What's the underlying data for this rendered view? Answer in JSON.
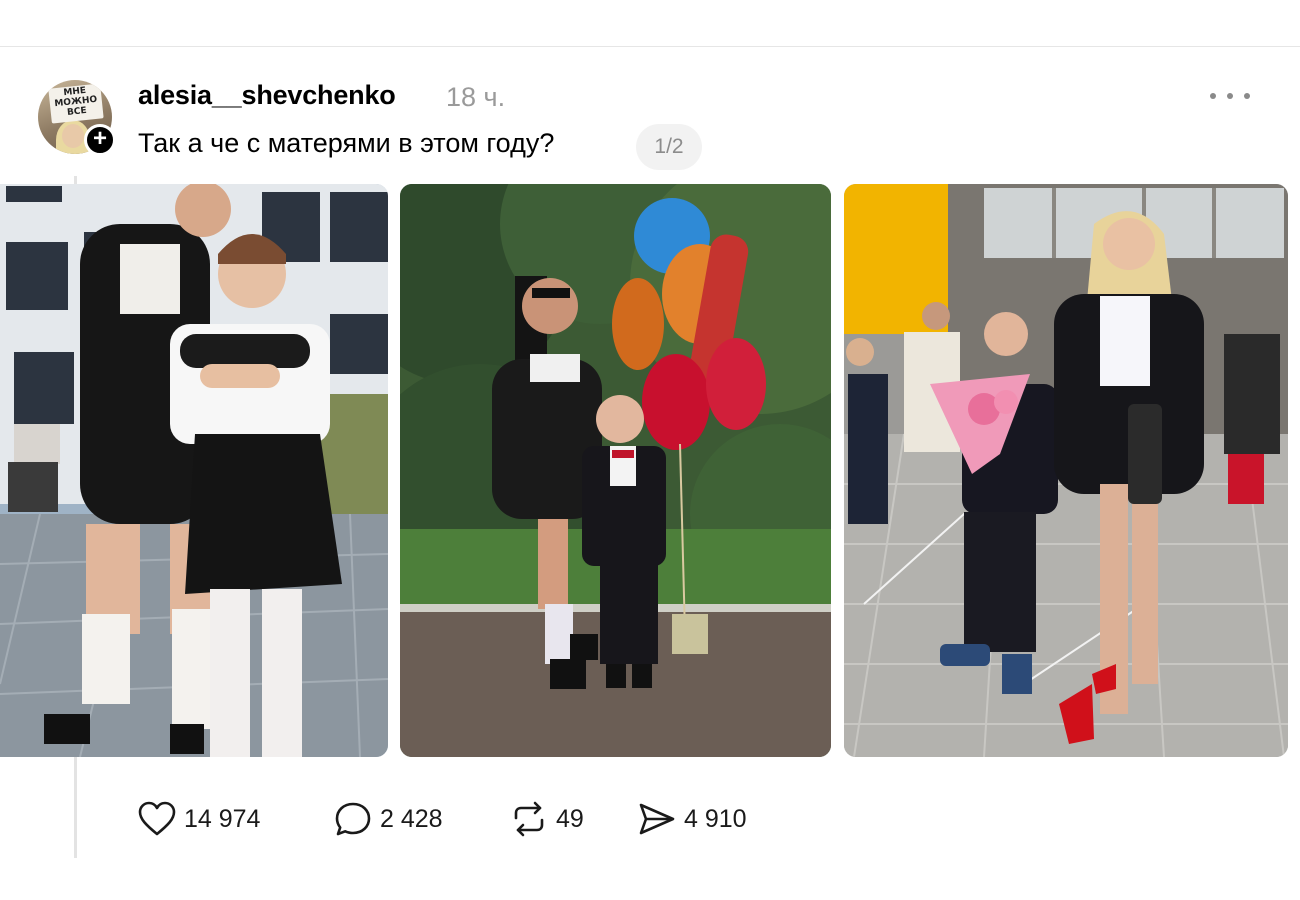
{
  "post": {
    "avatar_sign_text": "МНЕ МОЖНО ВСЕ",
    "username": "alesia__shevchenko",
    "timestamp": "18 ч.",
    "text": "Так а че с матерями в этом году?",
    "page_indicator": "1/2"
  },
  "actions": {
    "likes": "14 974",
    "comments": "2 428",
    "reposts": "49",
    "shares": "4 910"
  },
  "icons": {
    "like": "heart-icon",
    "comment": "speech-bubble-icon",
    "repost": "repost-arrows-icon",
    "share": "paper-plane-icon",
    "more": "more-dots-icon",
    "follow": "plus-icon"
  },
  "colors": {
    "text": "#000000",
    "muted": "#9a9a9a",
    "pill_bg": "#f2f2f2"
  }
}
